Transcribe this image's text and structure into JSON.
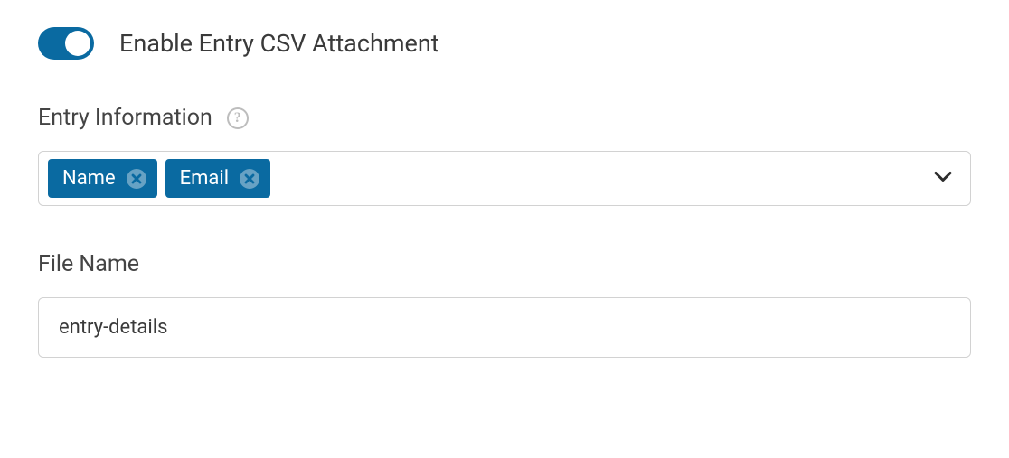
{
  "colors": {
    "accent": "#0a6aa1"
  },
  "toggle": {
    "label": "Enable Entry CSV Attachment",
    "enabled": true
  },
  "entryInfo": {
    "label": "Entry Information",
    "helpIcon": "help-icon",
    "tags": [
      {
        "label": "Name"
      },
      {
        "label": "Email"
      }
    ]
  },
  "fileName": {
    "label": "File Name",
    "value": "entry-details"
  }
}
